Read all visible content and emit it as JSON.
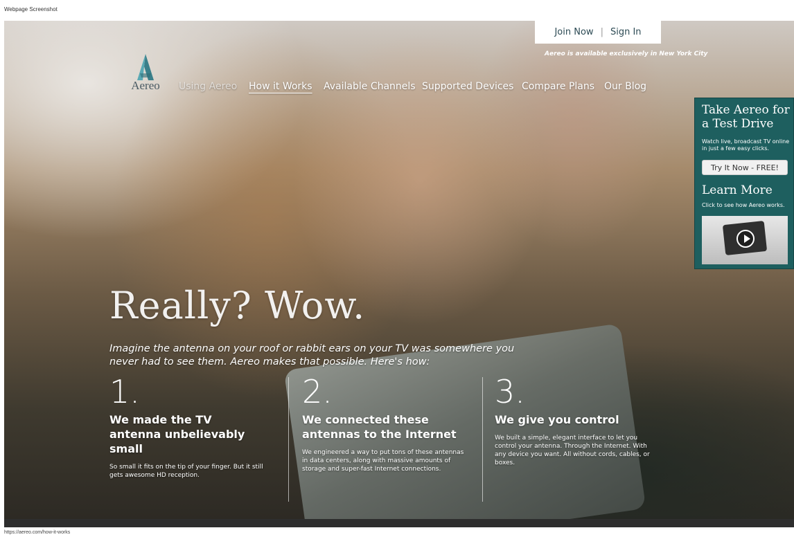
{
  "meta": {
    "caption": "Webpage Screenshot",
    "url": "https://aereo.com/how-it-works"
  },
  "brand": {
    "name": "Aereo"
  },
  "nav": {
    "items": [
      {
        "label": "Using Aereo"
      },
      {
        "label": "How it Works",
        "active": true
      },
      {
        "label": "Available Channels"
      },
      {
        "label": "Supported Devices"
      },
      {
        "label": "Compare Plans"
      },
      {
        "label": "Our Blog"
      }
    ]
  },
  "auth": {
    "join": "Join Now",
    "separator": "|",
    "sign_in": "Sign In"
  },
  "availability": "Aereo is available exclusively in New York City",
  "promo": {
    "title": "Take Aereo for a Test Drive",
    "subtitle": "Watch live, broadcast TV online in just a few easy clicks.",
    "button": "Try It Now - FREE!",
    "learn_title": "Learn More",
    "learn_sub": "Click to see how Aereo works."
  },
  "hero": {
    "headline": "Really? Wow.",
    "intro": "Imagine the antenna on your roof or rabbit ears on your TV was somewhere you never had to see them. Aereo makes that possible. Here's how:"
  },
  "steps": [
    {
      "num": "1.",
      "title": "We made the TV antenna unbelievably small",
      "body": "So small it fits on the tip of your finger. But it still gets awesome HD reception."
    },
    {
      "num": "2.",
      "title": "We connected these antennas to the Internet",
      "body": "We engineered a way to put tons of these antennas in data centers, along with massive amounts of storage and super-fast Internet connections."
    },
    {
      "num": "3.",
      "title": "We give you control",
      "body": "We built a simple, elegant interface to let you control your antenna. Through the Internet. With any device you want. All without cords, cables, or boxes."
    }
  ],
  "colors": {
    "promo_bg": "#1e5f5f",
    "logo": "#4a5a63",
    "auth_text": "#2c4a54"
  }
}
